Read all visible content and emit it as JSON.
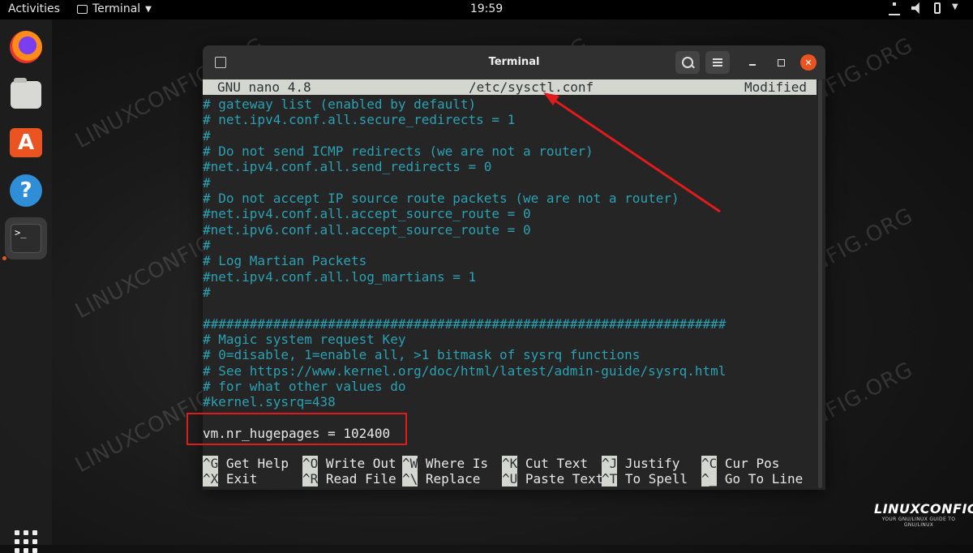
{
  "topbar": {
    "activities": "Activities",
    "app_name": "Terminal",
    "clock": "19:59"
  },
  "dock": {
    "items": [
      "firefox-icon",
      "files-icon",
      "software-icon",
      "help-icon",
      "terminal-icon"
    ],
    "terminal_glyph": ">_"
  },
  "window": {
    "title": "Terminal"
  },
  "nano": {
    "version": "GNU nano 4.8",
    "file": "/etc/sysctl.conf",
    "status": "Modified",
    "lines": [
      "# gateway list (enabled by default)",
      "# net.ipv4.conf.all.secure_redirects = 1",
      "#",
      "# Do not send ICMP redirects (we are not a router)",
      "#net.ipv4.conf.all.send_redirects = 0",
      "#",
      "# Do not accept IP source route packets (we are not a router)",
      "#net.ipv4.conf.all.accept_source_route = 0",
      "#net.ipv6.conf.all.accept_source_route = 0",
      "#",
      "# Log Martian Packets",
      "#net.ipv4.conf.all.log_martians = 1",
      "#",
      "",
      "###################################################################",
      "# Magic system request Key",
      "# 0=disable, 1=enable all, >1 bitmask of sysrq functions",
      "# See https://www.kernel.org/doc/html/latest/admin-guide/sysrq.html",
      "# for what other values do",
      "#kernel.sysrq=438",
      "",
      "vm.nr_hugepages = 102400"
    ],
    "shortcuts_row1": [
      {
        "key": "^G",
        "label": "Get Help"
      },
      {
        "key": "^O",
        "label": "Write Out"
      },
      {
        "key": "^W",
        "label": "Where Is"
      },
      {
        "key": "^K",
        "label": "Cut Text"
      },
      {
        "key": "^J",
        "label": "Justify"
      },
      {
        "key": "^C",
        "label": "Cur Pos"
      }
    ],
    "shortcuts_row2": [
      {
        "key": "^X",
        "label": "Exit"
      },
      {
        "key": "^R",
        "label": "Read File"
      },
      {
        "key": "^\\",
        "label": "Replace"
      },
      {
        "key": "^U",
        "label": "Paste Text"
      },
      {
        "key": "^T",
        "label": "To Spell"
      },
      {
        "key": "^_",
        "label": "Go To Line"
      }
    ]
  },
  "watermark": "LINUXCONFIG.ORG",
  "logo": {
    "brand": "LINUXCONFIG",
    "tagline": "YOUR GNU/LINUX GUIDE TO GNU/LINUX"
  },
  "colors": {
    "comment": "#2aa1b3",
    "annotation": "#e01b1b",
    "accent": "#e95420"
  }
}
